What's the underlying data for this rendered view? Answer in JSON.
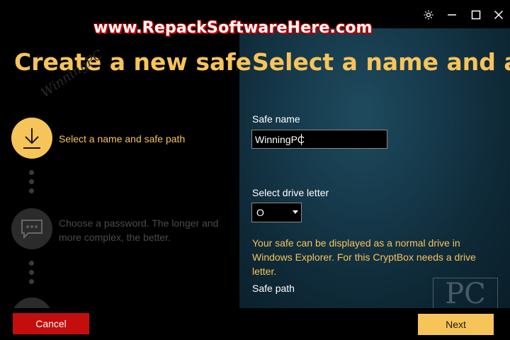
{
  "window": {
    "watermark": "www.RepackSoftwareHere.com",
    "controls": [
      "gear-icon",
      "minimize-icon",
      "maximize-icon",
      "close-icon"
    ]
  },
  "left": {
    "title": "Create a new safe",
    "watermark": "WinningPC",
    "steps": [
      {
        "label": "Select a name and safe path",
        "icon": "download-icon",
        "state": "active"
      },
      {
        "label": "Choose a password. The longer and more complex, the better.",
        "icon": "chat-bubble-icon",
        "state": "inactive"
      },
      {
        "icon": "wifi-icon",
        "state": "inactive"
      }
    ]
  },
  "right": {
    "title": "Select a name and a",
    "safe_name_label": "Safe name",
    "safe_name_value": "WinningPC",
    "drive_letter_label": "Select drive letter",
    "drive_letter_value": "O",
    "info_text": "Your safe can be displayed as a normal drive in Windows Explorer. For this CryptBox needs a drive letter.",
    "safe_path_label": "Safe path",
    "pc_watermark": "PC"
  },
  "buttons": {
    "cancel": "Cancel",
    "next": "Next"
  },
  "colors": {
    "accent": "#f7c45a",
    "cancel": "#c40d0d",
    "panel": "#163a4c",
    "background": "#000000"
  }
}
